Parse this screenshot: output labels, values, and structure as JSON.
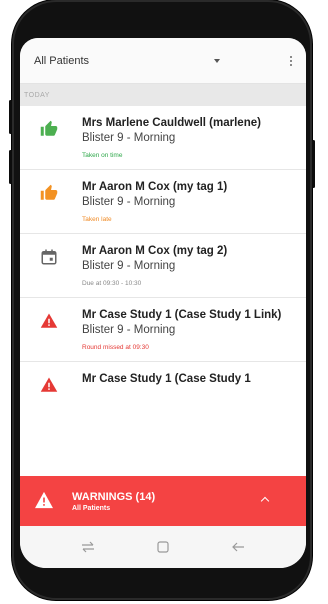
{
  "header": {
    "patient_filter": "All Patients"
  },
  "section": {
    "label": "TODAY"
  },
  "items": [
    {
      "title": "Mrs Marlene Cauldwell (marlene)",
      "subtitle": "Blister 9 - Morning",
      "status": "Taken on time",
      "status_color": "#2ea84a",
      "icon": "thumbs-up-icon",
      "icon_color": "#4caf50"
    },
    {
      "title": "Mr Aaron M Cox (my tag 1)",
      "subtitle": "Blister 9 - Morning",
      "status": "Taken late",
      "status_color": "#f08a24",
      "icon": "thumbs-up-icon",
      "icon_color": "#f39223"
    },
    {
      "title": "Mr Aaron M Cox (my tag 2)",
      "subtitle": "Blister 9 - Morning",
      "status": "Due at 09:30 - 10:30",
      "status_color": "#888888",
      "icon": "calendar-icon",
      "icon_color": "#666666"
    },
    {
      "title": "Mr Case Study 1 (Case Study 1 Link)",
      "subtitle": "Blister 9 - Morning",
      "status": "Round missed at 09:30",
      "status_color": "#e53935",
      "icon": "warning-icon",
      "icon_color": "#e53935"
    },
    {
      "title": "Mr Case Study 1 (Case Study 1",
      "subtitle": "",
      "status": "",
      "status_color": "#e53935",
      "icon": "warning-icon",
      "icon_color": "#e53935"
    }
  ],
  "warnings": {
    "title": "WARNINGS (14)",
    "subtitle": "All Patients",
    "color": "#f44343"
  },
  "navbar": {
    "icons": [
      "recent-apps-icon",
      "home-icon",
      "back-icon"
    ]
  }
}
